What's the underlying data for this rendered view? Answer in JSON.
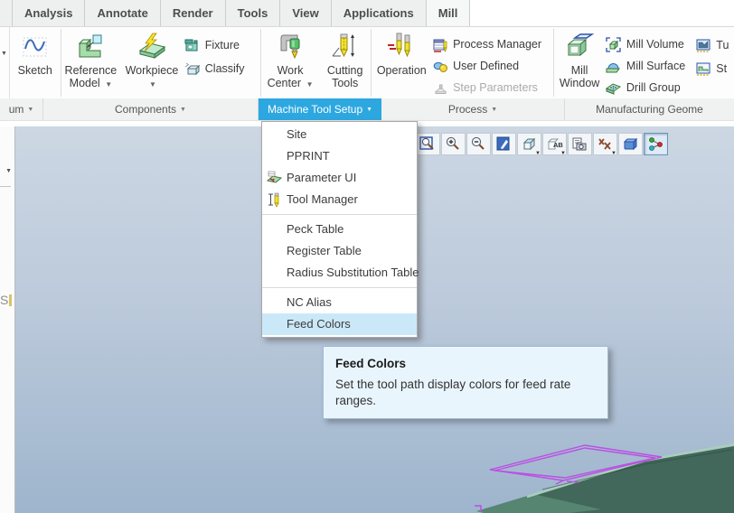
{
  "colors": {
    "group_highlight_bg": "#2da7e0",
    "menu_highlight_bg": "#cbe8f8",
    "tooltip_bg": "#e9f5fc",
    "viewport_gradient_top": "#ccd7e3",
    "viewport_gradient_bottom": "#9eb5cd",
    "model_green_dark": "#41685a",
    "model_green_mid": "#568572",
    "model_green_light": "#a8cfba",
    "wireframe_magenta": "#bb4fe4"
  },
  "glyphs": {
    "dropdown_arrow": "▼",
    "panel_arrow": "▼"
  },
  "tab_bar": {
    "active_tab": "Mill",
    "tabs": [
      {
        "label": "Analysis"
      },
      {
        "label": "Annotate"
      },
      {
        "label": "Render"
      },
      {
        "label": "Tools"
      },
      {
        "label": "View"
      },
      {
        "label": "Applications"
      },
      {
        "label": "Mill"
      }
    ]
  },
  "ribbon": {
    "sketch": "Sketch",
    "reference_model": "Reference Model",
    "workpiece": "Workpiece",
    "fixture": "Fixture",
    "classify": "Classify",
    "work_center": "Work Center",
    "cutting_tools": "Cutting Tools",
    "operation": "Operation",
    "process_manager": "Process Manager",
    "user_defined": "User Defined",
    "step_parameters": "Step Parameters",
    "mill_window": "Mill Window",
    "mill_volume": "Mill Volume",
    "mill_surface": "Mill Surface",
    "drill_group": "Drill Group",
    "turn_partial": "Tu",
    "step_partial": "St"
  },
  "group_row": {
    "datum_partial": "um",
    "components": "Components",
    "machine_tool_setup": "Machine Tool Setup",
    "process": "Process",
    "manufacturing_geometry_partial": "Manufacturing Geome"
  },
  "menu": {
    "title": "Machine Tool Setup",
    "highlighted_item": "Feed Colors",
    "items": [
      {
        "label": "Site"
      },
      {
        "label": "PPRINT"
      },
      {
        "label": "Parameter UI"
      },
      {
        "label": "Tool Manager"
      },
      {
        "label": "Peck Table"
      },
      {
        "label": "Register Table"
      },
      {
        "label": "Radius Substitution Table"
      },
      {
        "label": "NC Alias"
      },
      {
        "label": "Feed Colors"
      }
    ]
  },
  "tooltip": {
    "title": "Feed Colors",
    "body": "Set the tool path display colors for feed rate ranges."
  },
  "viewport_toolbar": {
    "ab_label": "AB",
    "buttons": [
      {
        "name": "zoom-region"
      },
      {
        "name": "zoom-in"
      },
      {
        "name": "zoom-out"
      },
      {
        "name": "repaint"
      },
      {
        "name": "display-style"
      },
      {
        "name": "annotation-display"
      },
      {
        "name": "saved-view-list"
      },
      {
        "name": "datum-display"
      },
      {
        "name": "view-manager"
      },
      {
        "name": "spin-center",
        "pressed": true
      }
    ]
  },
  "left_panel": {
    "partial_text": "S"
  }
}
